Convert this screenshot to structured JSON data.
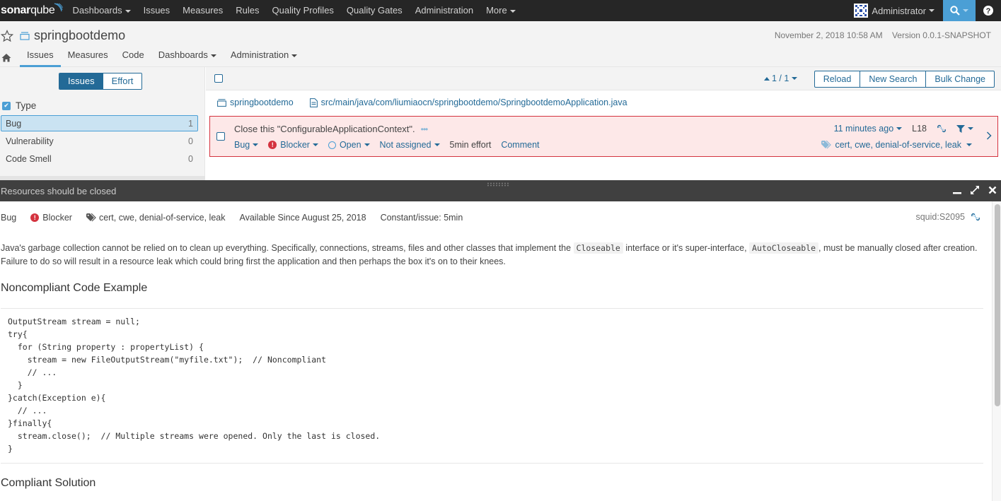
{
  "topnav": {
    "logo_bold": "sonar",
    "logo_light": "qube",
    "items": [
      {
        "label": "Dashboards",
        "dropdown": true
      },
      {
        "label": "Issues",
        "dropdown": false
      },
      {
        "label": "Measures",
        "dropdown": false
      },
      {
        "label": "Rules",
        "dropdown": false
      },
      {
        "label": "Quality Profiles",
        "dropdown": false
      },
      {
        "label": "Quality Gates",
        "dropdown": false
      },
      {
        "label": "Administration",
        "dropdown": false
      },
      {
        "label": "More",
        "dropdown": true
      }
    ],
    "user": "Administrator",
    "search_icon": "search-icon",
    "help_icon": "help-icon"
  },
  "context": {
    "project_name": "springbootdemo",
    "date": "November 2, 2018 10:58 AM",
    "version": "Version 0.0.1-SNAPSHOT",
    "tabs": [
      {
        "label": "Issues",
        "active": true
      },
      {
        "label": "Measures",
        "active": false
      },
      {
        "label": "Code",
        "active": false
      },
      {
        "label": "Dashboards",
        "active": false,
        "dropdown": true
      },
      {
        "label": "Administration",
        "active": false,
        "dropdown": true
      }
    ]
  },
  "sidebar": {
    "mode_issues": "Issues",
    "mode_effort": "Effort",
    "facet_title": "Type",
    "facet_items": [
      {
        "label": "Bug",
        "count": "1",
        "selected": true
      },
      {
        "label": "Vulnerability",
        "count": "0",
        "selected": false
      },
      {
        "label": "Code Smell",
        "count": "0",
        "selected": false
      }
    ]
  },
  "main": {
    "paging": "1 / 1",
    "buttons": {
      "reload": "Reload",
      "new_search": "New Search",
      "bulk_change": "Bulk Change"
    },
    "breadcrumb": {
      "project": "springbootdemo",
      "file": "src/main/java/com/liumiaocn/springbootdemo/SpringbootdemoApplication.java"
    },
    "issue": {
      "message": "Close this \"ConfigurableApplicationContext\".",
      "more": "•••",
      "type": "Bug",
      "severity": "Blocker",
      "status": "Open",
      "assignee": "Not assigned",
      "effort": "5min effort",
      "comment": "Comment",
      "age": "11 minutes ago",
      "line": "L18",
      "tags": "cert, cwe, denial-of-service, leak"
    }
  },
  "rule": {
    "title": "Resources should be closed",
    "type": "Bug",
    "severity": "Blocker",
    "tags": "cert, cwe, denial-of-service, leak",
    "available_since": "Available Since August 25, 2018",
    "remediation": "Constant/issue: 5min",
    "key": "squid:S2095",
    "desc_part1": "Java's garbage collection cannot be relied on to clean up everything. Specifically, connections, streams, files and other classes that implement the ",
    "desc_code1": "Closeable",
    "desc_part2": " interface or it's super-interface, ",
    "desc_code2": "AutoCloseable",
    "desc_part3": ", must be manually closed after creation. Failure to do so will result in a resource leak which could bring first the application and then perhaps the box it's on to their knees.",
    "noncompliant_heading": "Noncompliant Code Example",
    "noncompliant_code": "OutputStream stream = null;\ntry{\n  for (String property : propertyList) {\n    stream = new FileOutputStream(\"myfile.txt\");  // Noncompliant\n    // ...\n  }\n}catch(Exception e){\n  // ...\n}finally{\n  stream.close();  // Multiple streams were opened. Only the last is closed.\n}",
    "compliant_heading": "Compliant Solution"
  },
  "colors": {
    "nav_bg": "#262626",
    "accent": "#4b9fd5",
    "link": "#236a97",
    "blocker": "#d4333f",
    "issue_bg": "#fde8e8"
  }
}
